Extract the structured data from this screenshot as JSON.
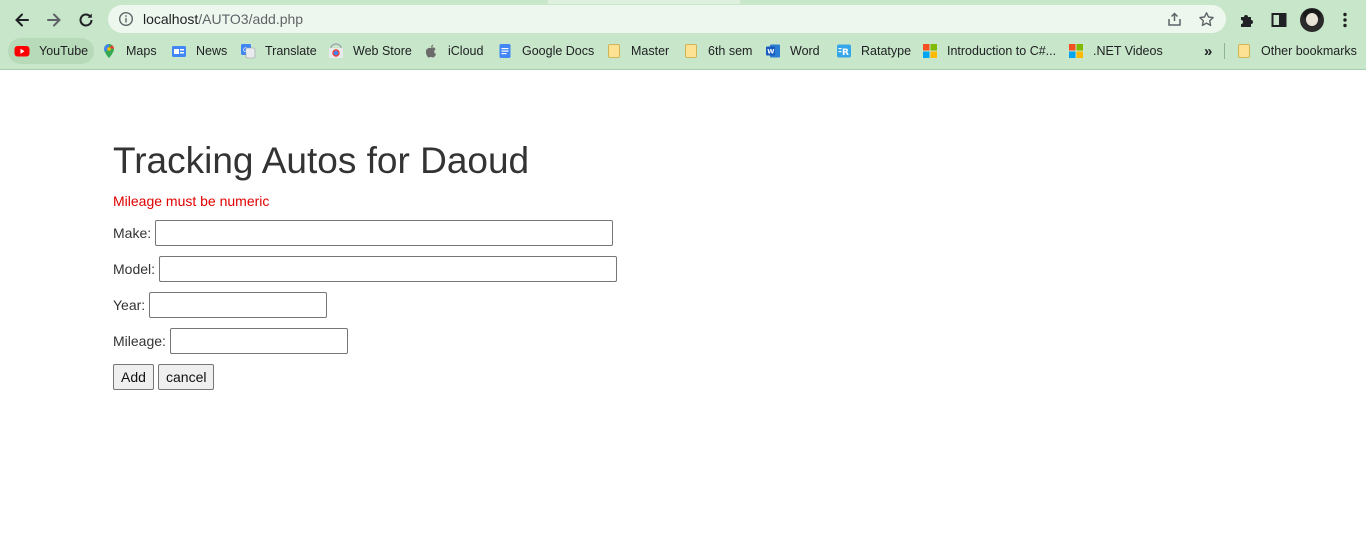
{
  "browser": {
    "url_host": "localhost",
    "url_path": "/AUTO3/add.php",
    "bookmarks": [
      {
        "label": "YouTube",
        "icon": "youtube-icon"
      },
      {
        "label": "Maps",
        "icon": "maps-icon"
      },
      {
        "label": "News",
        "icon": "news-icon"
      },
      {
        "label": "Translate",
        "icon": "translate-icon"
      },
      {
        "label": "Web Store",
        "icon": "web-store-icon"
      },
      {
        "label": "iCloud",
        "icon": "apple-icon"
      },
      {
        "label": "Google Docs",
        "icon": "docs-icon"
      },
      {
        "label": "Master",
        "icon": "folder-icon"
      },
      {
        "label": "6th sem",
        "icon": "folder-icon"
      },
      {
        "label": "Word",
        "icon": "word-icon"
      },
      {
        "label": "Ratatype",
        "icon": "ratatype-icon"
      },
      {
        "label": "Introduction to C#...",
        "icon": "microsoft-icon"
      },
      {
        "label": ".NET Videos",
        "icon": "microsoft-icon"
      }
    ],
    "overflow_label": "»",
    "other_bookmarks": "Other bookmarks"
  },
  "page": {
    "title": "Tracking Autos for Daoud",
    "error": "Mileage must be numeric",
    "fields": {
      "make": {
        "label": "Make:",
        "value": ""
      },
      "model": {
        "label": "Model:",
        "value": ""
      },
      "year": {
        "label": "Year:",
        "value": ""
      },
      "mileage": {
        "label": "Mileage:",
        "value": ""
      }
    },
    "buttons": {
      "add": "Add",
      "cancel": "cancel"
    }
  },
  "colors": {
    "chrome": "#c8e6c9",
    "error": "#e00000",
    "title": "#333333"
  }
}
